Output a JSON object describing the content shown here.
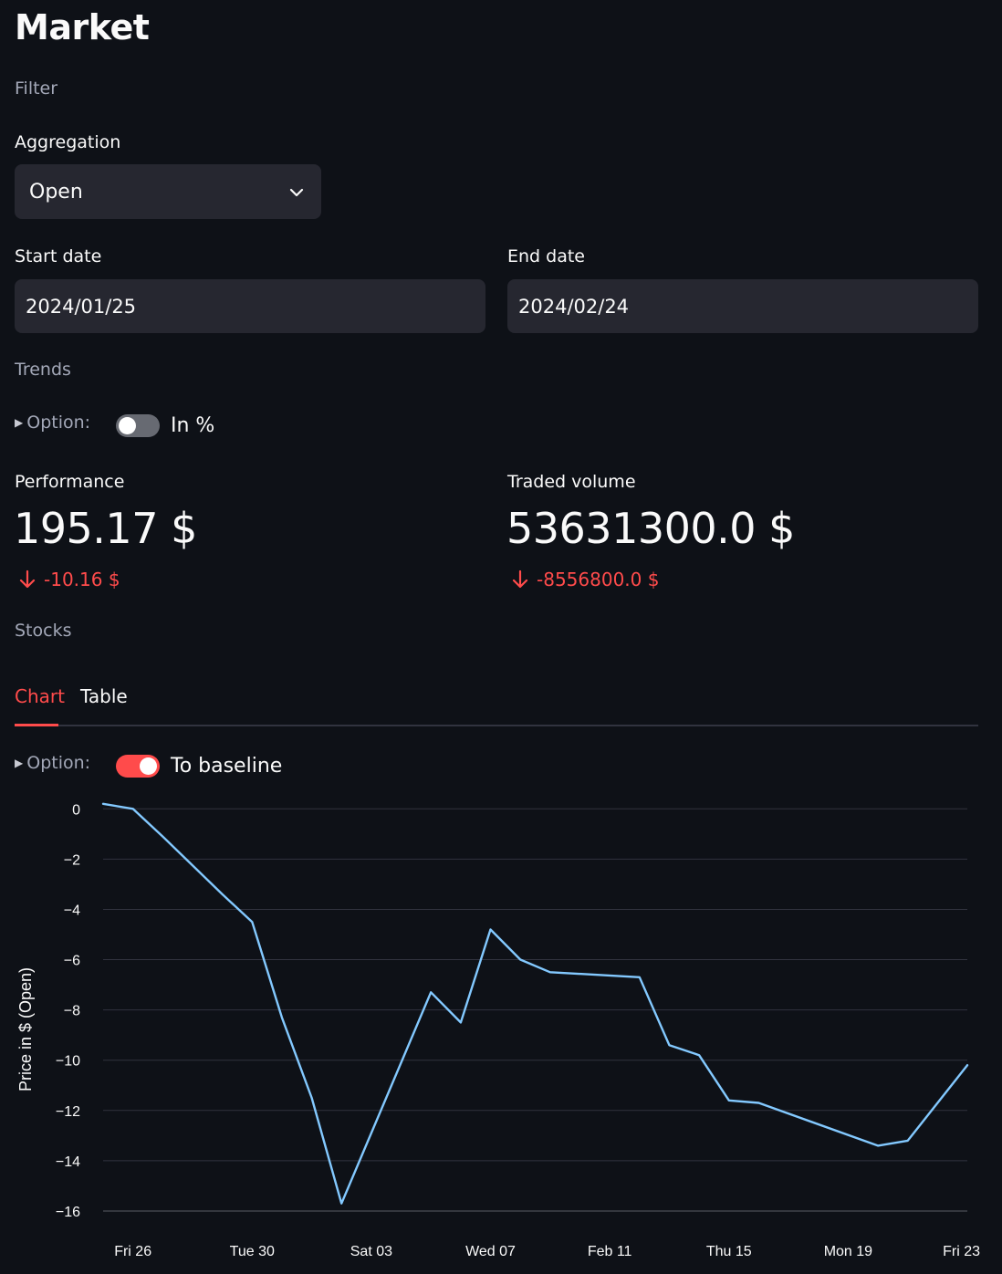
{
  "page": {
    "title": "Market",
    "filter_section": "Filter",
    "trends_section": "Trends",
    "stocks_section": "Stocks"
  },
  "aggregation": {
    "label": "Aggregation",
    "value": "Open",
    "icon": "chevron-down-icon"
  },
  "dates": {
    "start_label": "Start date",
    "start_value": "2024/01/25",
    "end_label": "End date",
    "end_value": "2024/02/24"
  },
  "trends_option": {
    "expander_label": "Option:",
    "toggle_label": "In %",
    "toggle_on": false
  },
  "metrics": [
    {
      "label": "Performance",
      "value": "195.17 $",
      "delta": "-10.16 $",
      "direction": "down"
    },
    {
      "label": "Traded volume",
      "value": "53631300.0 $",
      "delta": "-8556800.0 $",
      "direction": "down"
    }
  ],
  "tabs": [
    {
      "label": "Chart",
      "active": true
    },
    {
      "label": "Table",
      "active": false
    }
  ],
  "chart_option": {
    "expander_label": "Option:",
    "toggle_label": "To baseline",
    "toggle_on": true
  },
  "colors": {
    "accent": "#ff4b4b",
    "background": "#0e1117",
    "input_bg": "#262730",
    "line": "#83c9ff"
  },
  "chart_data": {
    "type": "line",
    "title": "",
    "xlabel": "",
    "ylabel": "Price in $ (Open)",
    "ylim": [
      -16.4,
      0.3
    ],
    "yticks": [
      0,
      -2,
      -4,
      -6,
      -8,
      -10,
      -12,
      -14,
      -16
    ],
    "xlim": [
      "2024-01-25",
      "2024-02-23"
    ],
    "xticks": [
      {
        "date": "2024-01-26",
        "label": "Fri 26"
      },
      {
        "date": "2024-01-30",
        "label": "Tue 30"
      },
      {
        "date": "2024-02-03",
        "label": "Sat 03"
      },
      {
        "date": "2024-02-07",
        "label": "Wed 07"
      },
      {
        "date": "2024-02-11",
        "label": "Feb 11"
      },
      {
        "date": "2024-02-15",
        "label": "Thu 15"
      },
      {
        "date": "2024-02-19",
        "label": "Mon 19"
      },
      {
        "date": "2024-02-23",
        "label": "Fri 23"
      }
    ],
    "grid": true,
    "series": [
      {
        "points": [
          [
            "2024-01-25",
            0.2
          ],
          [
            "2024-01-26",
            0.0
          ],
          [
            "2024-01-27",
            -1.1
          ],
          [
            "2024-01-29",
            -3.4
          ],
          [
            "2024-01-30",
            -4.5
          ],
          [
            "2024-01-31",
            -8.3
          ],
          [
            "2024-02-01",
            -11.5
          ],
          [
            "2024-02-02",
            -15.7
          ],
          [
            "2024-02-05",
            -7.3
          ],
          [
            "2024-02-06",
            -8.5
          ],
          [
            "2024-02-07",
            -4.8
          ],
          [
            "2024-02-08",
            -6.0
          ],
          [
            "2024-02-09",
            -6.5
          ],
          [
            "2024-02-12",
            -6.7
          ],
          [
            "2024-02-13",
            -9.4
          ],
          [
            "2024-02-14",
            -9.8
          ],
          [
            "2024-02-15",
            -11.6
          ],
          [
            "2024-02-16",
            -11.7
          ],
          [
            "2024-02-20",
            -13.4
          ],
          [
            "2024-02-21",
            -13.2
          ],
          [
            "2024-02-23",
            -10.2
          ]
        ]
      }
    ]
  }
}
